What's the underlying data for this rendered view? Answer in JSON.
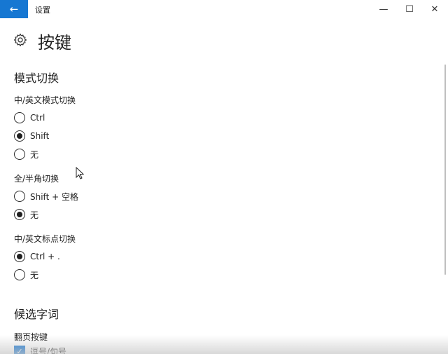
{
  "window": {
    "title": "设置",
    "back_icon": "←",
    "min_icon": "—",
    "max_icon": "☐",
    "close_icon": "✕"
  },
  "page": {
    "title": "按键"
  },
  "sections": {
    "mode_switch": {
      "title": "模式切换",
      "groups": {
        "cn_en_mode": {
          "label": "中/英文模式切换",
          "options": [
            "Ctrl",
            "Shift",
            "无"
          ],
          "selected": "Shift"
        },
        "full_half": {
          "label": "全/半角切换",
          "options": [
            "Shift + 空格",
            "无"
          ],
          "selected": "无"
        },
        "punct": {
          "label": "中/英文标点切换",
          "options": [
            "Ctrl + .",
            "无"
          ],
          "selected": "Ctrl + ."
        }
      }
    },
    "candidates": {
      "title": "候选字词",
      "paging_label": "翻页按键",
      "paging_option": "逗号/句号"
    }
  },
  "colors": {
    "accent": "#1677d2"
  }
}
